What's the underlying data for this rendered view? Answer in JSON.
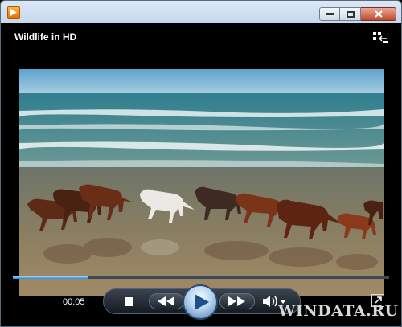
{
  "window": {
    "icon": "media-player-icon",
    "controls": [
      "minimize-icon",
      "maximize-icon",
      "close-icon"
    ]
  },
  "header": {
    "title": "Wildlife in HD",
    "switch_icon": "switch-to-library-icon"
  },
  "video": {
    "description_icon": "video-frame-horses-on-beach"
  },
  "playback": {
    "time": "00:05",
    "progress": 0.2
  },
  "controls": {
    "stop_icon": "stop-icon",
    "prev_icon": "rewind-icon",
    "play_icon": "play-icon",
    "next_icon": "fast-forward-icon",
    "volume_icon": "speaker-icon",
    "volume_menu_icon": "chevron-down-icon",
    "fullscreen_icon": "fullscreen-icon"
  },
  "watermark": "WINDATA.RU",
  "colors": {
    "accent": "#2a80d4",
    "sea": "#4d8e96",
    "sky": "#79b3d6",
    "sand": "#8a7a5e"
  }
}
